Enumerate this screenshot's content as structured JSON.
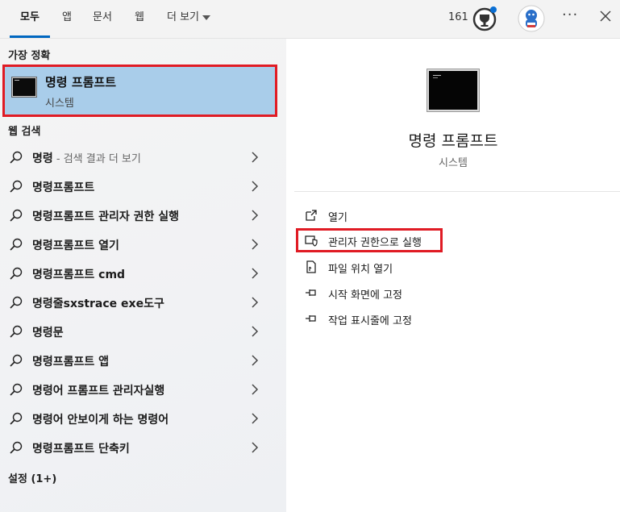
{
  "tabs": [
    {
      "label": "모두"
    },
    {
      "label": "앱"
    },
    {
      "label": "문서"
    },
    {
      "label": "웹"
    },
    {
      "label": "더 보기"
    }
  ],
  "header": {
    "points": "161"
  },
  "best_match": {
    "heading": "가장 정확",
    "title": "명령 프롬프트",
    "subtitle": "시스템"
  },
  "web_search": {
    "heading": "웹 검색",
    "items": [
      {
        "text": "명령",
        "suffix": " - 검색 결과 더 보기"
      },
      {
        "text": "명령프롬프트",
        "suffix": ""
      },
      {
        "text": "명령프롬프트 관리자 권한 실행",
        "suffix": ""
      },
      {
        "text": "명령프롬프트 열기",
        "suffix": ""
      },
      {
        "text": "명령프롬프트 cmd",
        "suffix": ""
      },
      {
        "text": "명령줄sxstrace exe도구",
        "suffix": ""
      },
      {
        "text": "명령문",
        "suffix": ""
      },
      {
        "text": "명령프롬프트 앱",
        "suffix": ""
      },
      {
        "text": "명령어 프롬프트 관리자실행",
        "suffix": ""
      },
      {
        "text": "명령어 안보이게 하는 명령어",
        "suffix": ""
      },
      {
        "text": "명령프롬프트 단축키",
        "suffix": ""
      }
    ]
  },
  "settings": {
    "heading": "설정 (1+)"
  },
  "detail": {
    "title": "명령 프롬프트",
    "subtitle": "시스템",
    "actions": [
      {
        "label": "열기",
        "icon": "open-icon"
      },
      {
        "label": "관리자 권한으로 실행",
        "icon": "shield-icon"
      },
      {
        "label": "파일 위치 열기",
        "icon": "file-location-icon"
      },
      {
        "label": "시작 화면에 고정",
        "icon": "pin-icon"
      },
      {
        "label": "작업 표시줄에 고정",
        "icon": "pin-icon"
      }
    ]
  },
  "colors": {
    "accent": "#0067c0",
    "selection": "#a9cdea",
    "highlight_box": "#e01b24"
  }
}
